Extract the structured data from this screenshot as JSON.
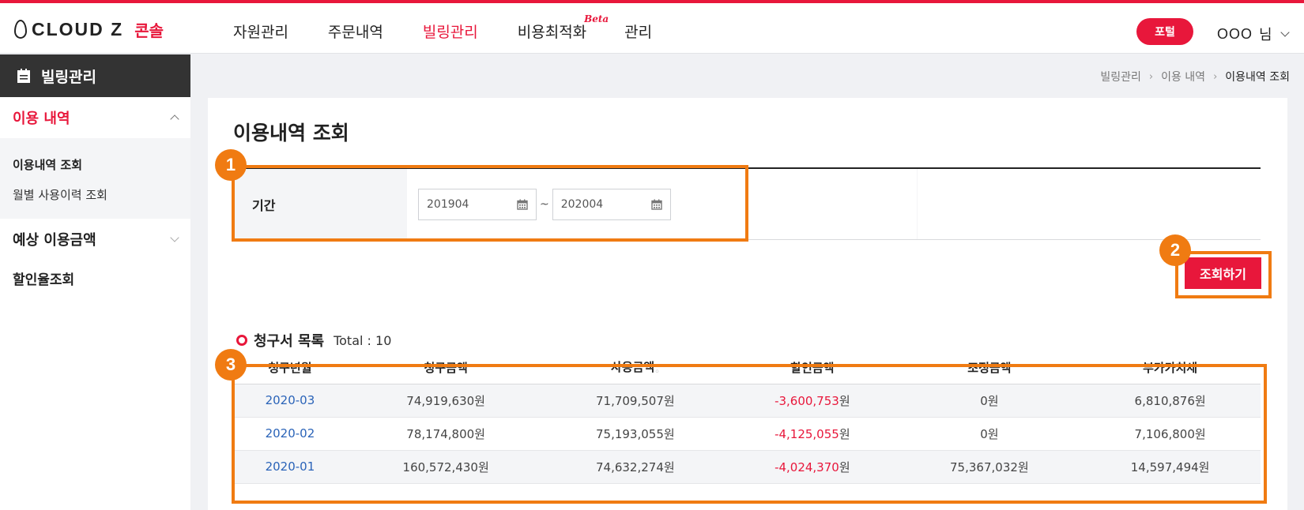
{
  "brand": {
    "logo_text": "CLOUD Z",
    "logo_sub": "콘솔"
  },
  "nav": {
    "items": [
      {
        "label": "자원관리"
      },
      {
        "label": "주문내역"
      },
      {
        "label": "빌링관리"
      },
      {
        "label": "비용최적화"
      },
      {
        "label": "관리"
      }
    ],
    "beta_label": "Beta"
  },
  "header": {
    "portal_label": "포털",
    "user_name": "OOO",
    "user_suffix": "님"
  },
  "sidebar": {
    "title": "빌링관리",
    "group_usage": "이용 내역",
    "sub_items": [
      {
        "label": "이용내역 조회"
      },
      {
        "label": "월별 사용이력 조회"
      }
    ],
    "group_expected": "예상 이용금액",
    "plain_item": "할인율조회"
  },
  "breadcrumb": [
    "빌링관리",
    "이용 내역",
    "이용내역 조회"
  ],
  "page": {
    "title": "이용내역 조회"
  },
  "filter": {
    "period_label": "기간",
    "from": "201904",
    "tilde": "~",
    "to": "202004"
  },
  "search_button": "조회하기",
  "list": {
    "title": "청구서 목록",
    "total_label": "Total : 10"
  },
  "table": {
    "headers": [
      "청구년월",
      "청구금액",
      "사용금액",
      "할인금액",
      "조정금액",
      "부가가치세"
    ],
    "rows": [
      {
        "month": "2020-03",
        "billed": "74,919,630원",
        "used": "71,709,507원",
        "discount_num": "-3,600,753",
        "discount_unit": "원",
        "adjust": "0원",
        "vat": "6,810,876원"
      },
      {
        "month": "2020-02",
        "billed": "78,174,800원",
        "used": "75,193,055원",
        "discount_num": "-4,125,055",
        "discount_unit": "원",
        "adjust": "0원",
        "vat": "7,106,800원"
      },
      {
        "month": "2020-01",
        "billed": "160,572,430원",
        "used": "74,632,274원",
        "discount_num": "-4,024,370",
        "discount_unit": "원",
        "adjust": "75,367,032원",
        "vat": "14,597,494원"
      }
    ]
  },
  "callouts": [
    "1",
    "2",
    "3"
  ],
  "colors": {
    "accent": "#e8173b",
    "callout": "#f07b12",
    "link": "#2a63b8"
  }
}
